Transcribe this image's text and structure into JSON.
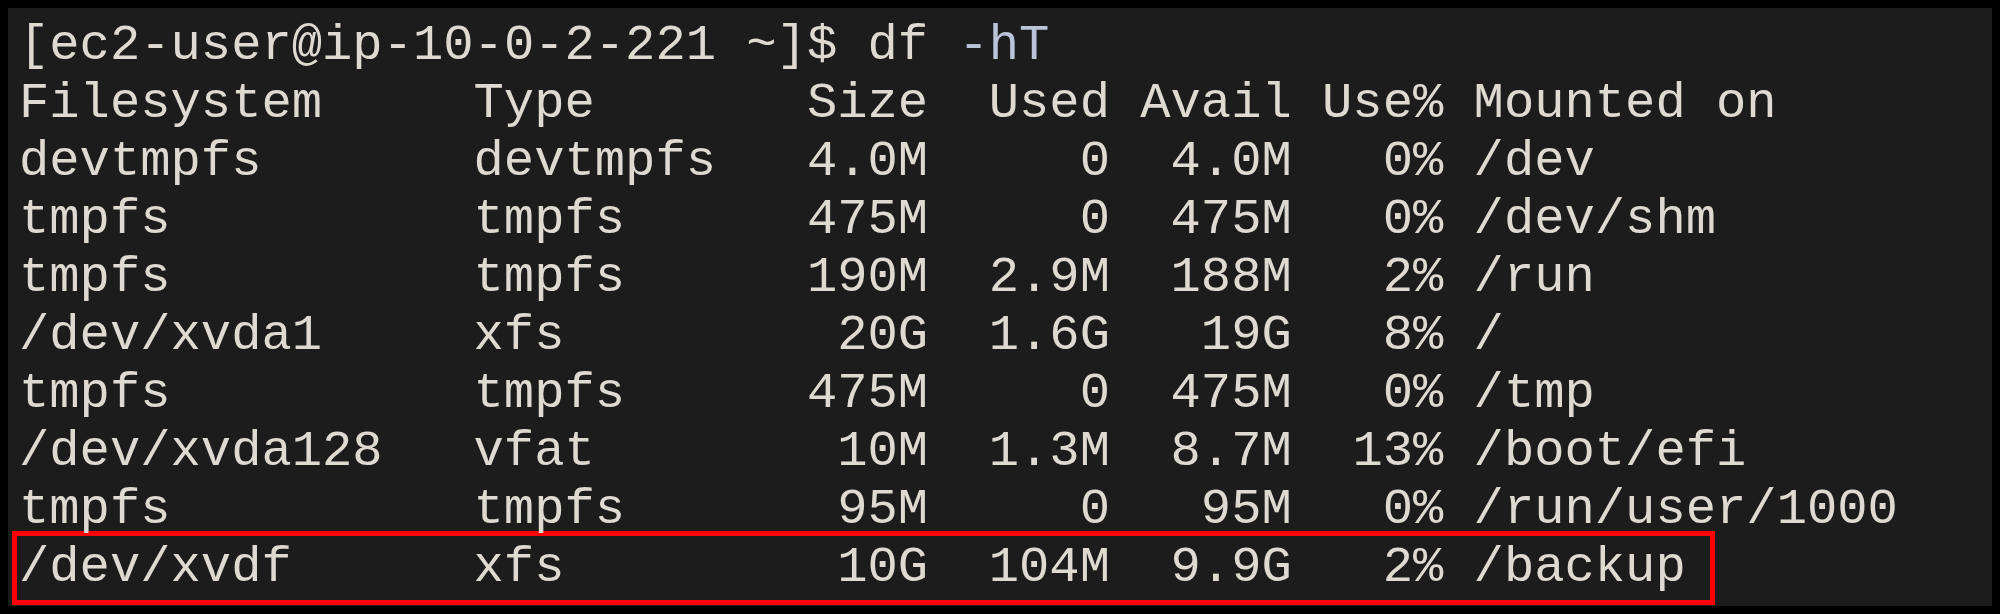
{
  "terminal": {
    "prompt": "[ec2-user@ip-10-0-2-221 ~]$",
    "command": "df",
    "option": "-hT",
    "columns": [
      "Filesystem",
      "Type",
      "Size",
      "Used",
      "Avail",
      "Use%",
      "Mounted on"
    ],
    "rows": [
      {
        "cells": [
          "devtmpfs",
          "devtmpfs",
          "4.0M",
          "0",
          "4.0M",
          "0%",
          "/dev"
        ],
        "highlighted": false
      },
      {
        "cells": [
          "tmpfs",
          "tmpfs",
          "475M",
          "0",
          "475M",
          "0%",
          "/dev/shm"
        ],
        "highlighted": false
      },
      {
        "cells": [
          "tmpfs",
          "tmpfs",
          "190M",
          "2.9M",
          "188M",
          "2%",
          "/run"
        ],
        "highlighted": false
      },
      {
        "cells": [
          "/dev/xvda1",
          "xfs",
          "20G",
          "1.6G",
          "19G",
          "8%",
          "/"
        ],
        "highlighted": false
      },
      {
        "cells": [
          "tmpfs",
          "tmpfs",
          "475M",
          "0",
          "475M",
          "0%",
          "/tmp"
        ],
        "highlighted": false
      },
      {
        "cells": [
          "/dev/xvda128",
          "vfat",
          "10M",
          "1.3M",
          "8.7M",
          "13%",
          "/boot/efi"
        ],
        "highlighted": false
      },
      {
        "cells": [
          "tmpfs",
          "tmpfs",
          "95M",
          "0",
          "95M",
          "0%",
          "/run/user/1000"
        ],
        "highlighted": false
      },
      {
        "cells": [
          "/dev/xvdf",
          "xfs",
          "10G",
          "104M",
          "9.9G",
          "2%",
          "/backup"
        ],
        "highlighted": true
      }
    ]
  }
}
